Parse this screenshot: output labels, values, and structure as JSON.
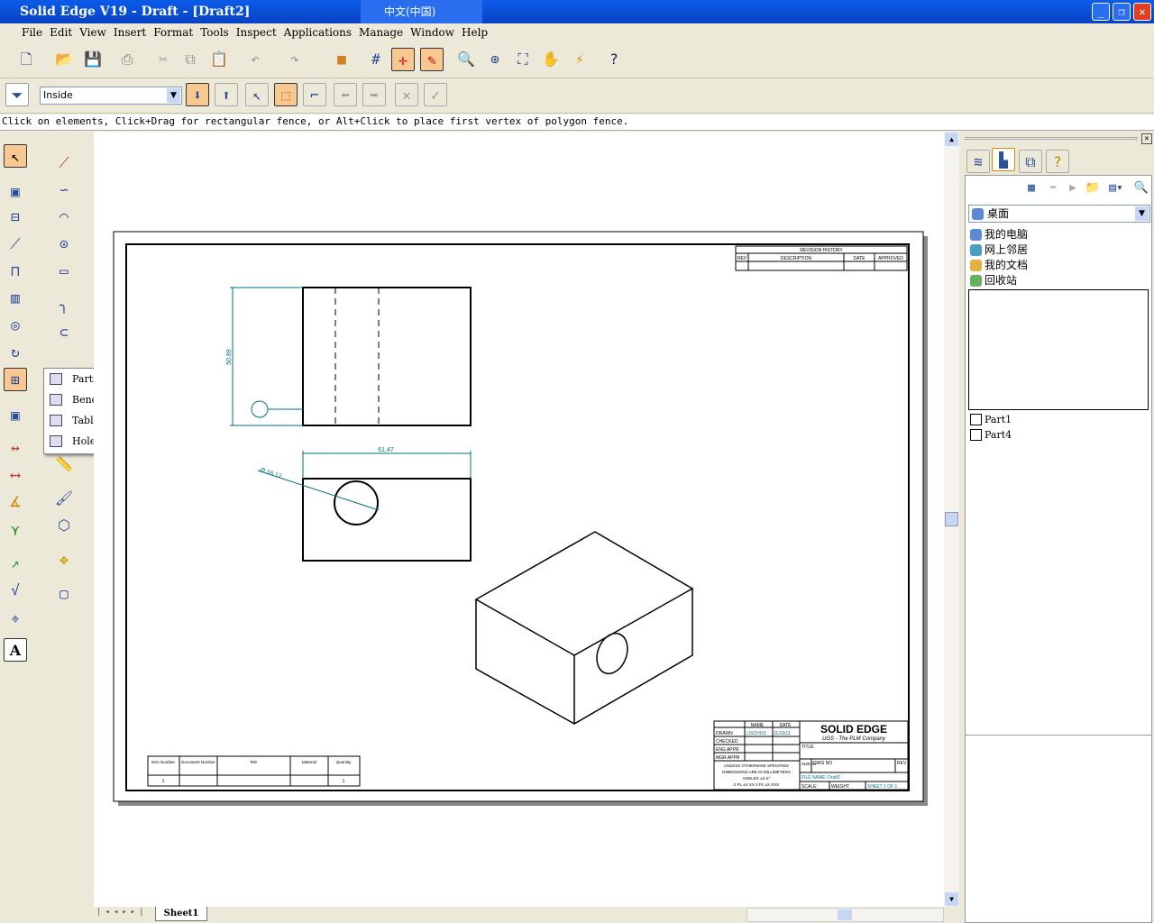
{
  "window": {
    "title": "Solid Edge V19 - Draft - [Draft2]",
    "ime": "中文(中国)"
  },
  "menu": [
    "File",
    "Edit",
    "View",
    "Insert",
    "Format",
    "Tools",
    "Inspect",
    "Applications",
    "Manage",
    "Window",
    "Help"
  ],
  "select_toolbar": {
    "mode": "Inside"
  },
  "status": "Click on elements, Click+Drag for rectangular fence, or Alt+Click to place first vertex of polygon fence.",
  "popup_menu": [
    "Parts List",
    "Bend Table",
    "Table",
    "Hole Table"
  ],
  "sheet_tab": "Sheet1",
  "drawing": {
    "dims": {
      "height": "50.89",
      "width": "61.47",
      "diameter": "Ø 16.12"
    },
    "revision_history": {
      "title": "REVISION HISTORY",
      "cols": [
        "REV",
        "DESCRIPTION",
        "DATE",
        "APPROVED"
      ]
    },
    "title_block": {
      "brand": "SOLID EDGE",
      "tagline": "UGS - The PLM Company",
      "cols": [
        "NAME",
        "DATE"
      ],
      "rows": [
        "DRAWN",
        "CHECKED",
        "ENG APPR",
        "MGR APPR"
      ],
      "drawn_name": "LISCHUS",
      "drawn_date": "11/19/11",
      "title_lbl": "TITLE",
      "size": "SIZE A2",
      "dwg": "DWG NO",
      "rev": "REV",
      "file": "FILE NAME: Draft2",
      "scale": "SCALE:",
      "weight": "WEIGHT",
      "sheet": "SHEET 1 OF 1",
      "tolerance": [
        "UNLESS OTHERWISE SPECIFIED",
        "DIMENSIONS ARE IN MILLIMETERS",
        "ANGLES ±X.X°",
        "2 PL ±X.XX 3 PL ±X.XXX"
      ]
    },
    "parts_list": {
      "cols": [
        "Item Number",
        "Document Number",
        "Title",
        "Material",
        "Quantity"
      ],
      "row": [
        "1",
        "",
        "",
        "",
        "1"
      ]
    }
  },
  "library": {
    "location": "桌面",
    "items": [
      "我的电脑",
      "网上邻居",
      "我的文档",
      "回收站"
    ],
    "files": [
      "Part1",
      "Part4"
    ]
  }
}
